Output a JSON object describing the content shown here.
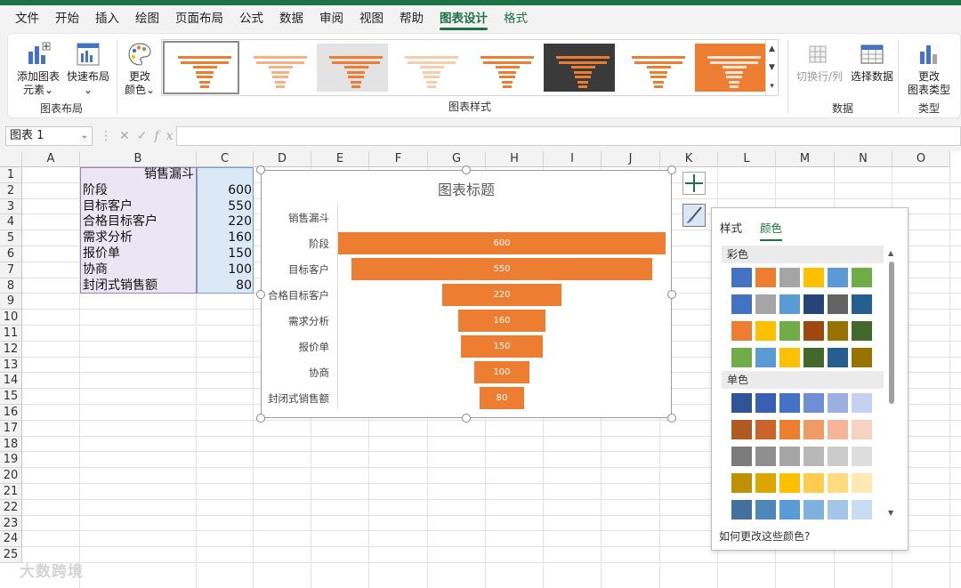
{
  "menu": {
    "items": [
      "文件",
      "开始",
      "插入",
      "绘图",
      "页面布局",
      "公式",
      "数据",
      "审阅",
      "视图",
      "帮助",
      "图表设计",
      "格式"
    ],
    "active": "图表设计"
  },
  "ribbon": {
    "layout_group": {
      "label": "图表布局",
      "add_element": "添加图表\n元素",
      "quick_layout": "快速布局"
    },
    "change_colors": "更改\n颜色",
    "styles_group_label": "图表样式",
    "data_group": {
      "label": "数据",
      "switch_row_col": "切换行/列",
      "select_data": "选择数据"
    },
    "type_group": {
      "label": "类型",
      "change_type": "更改\n图表类型"
    }
  },
  "formula_bar": {
    "name_box": "图表 1",
    "fx": "fx",
    "value": ""
  },
  "columns": [
    "A",
    "B",
    "C",
    "D",
    "E",
    "F",
    "G",
    "H",
    "I",
    "J",
    "K",
    "L",
    "M",
    "N",
    "O"
  ],
  "rows": [
    "1",
    "2",
    "3",
    "4",
    "5",
    "6",
    "7",
    "8",
    "9",
    "10",
    "11",
    "12",
    "13",
    "14",
    "15",
    "16",
    "17",
    "18",
    "19",
    "20",
    "21",
    "22",
    "23",
    "24",
    "25"
  ],
  "sheet": {
    "header": "销售漏斗",
    "data": [
      {
        "stage": "阶段",
        "value": "600"
      },
      {
        "stage": "目标客户",
        "value": "550"
      },
      {
        "stage": "合格目标客户",
        "value": "220"
      },
      {
        "stage": "需求分析",
        "value": "160"
      },
      {
        "stage": "报价单",
        "value": "150"
      },
      {
        "stage": "协商",
        "value": "100"
      },
      {
        "stage": "封闭式销售额",
        "value": "80"
      }
    ]
  },
  "chart_data": {
    "type": "funnel",
    "title": "图表标题",
    "categories": [
      "销售漏斗",
      "阶段",
      "目标客户",
      "合格目标客户",
      "需求分析",
      "报价单",
      "协商",
      "封闭式销售额"
    ],
    "values": [
      null,
      600,
      550,
      220,
      160,
      150,
      100,
      80
    ],
    "color": "#ed7d31",
    "data_labels": true
  },
  "color_panel": {
    "tabs": [
      "样式",
      "颜色"
    ],
    "active_tab": "颜色",
    "colorful_label": "彩色",
    "mono_label": "单色",
    "footer": "如何更改这些颜色?",
    "colorful_rows": [
      [
        "#4472c4",
        "#ed7d31",
        "#a5a5a5",
        "#ffc000",
        "#5b9bd5",
        "#70ad47"
      ],
      [
        "#4472c4",
        "#a5a5a5",
        "#5b9bd5",
        "#264478",
        "#636363",
        "#255e91"
      ],
      [
        "#ed7d31",
        "#ffc000",
        "#70ad47",
        "#9e480e",
        "#997300",
        "#43682b"
      ],
      [
        "#70ad47",
        "#5b9bd5",
        "#ffc000",
        "#43682b",
        "#255e91",
        "#997300"
      ]
    ],
    "mono_rows": [
      [
        "#2f5597",
        "#3a5fb0",
        "#4472c4",
        "#6f8ed4",
        "#9bb0e1",
        "#c5d1ee"
      ],
      [
        "#ae5a21",
        "#c9652a",
        "#ed7d31",
        "#f09a66",
        "#f4b598",
        "#f8d1c0"
      ],
      [
        "#7b7b7b",
        "#8f8f8f",
        "#a5a5a5",
        "#b8b8b8",
        "#cbcbcb",
        "#dddddd"
      ],
      [
        "#bf9000",
        "#dba600",
        "#ffc000",
        "#ffcd4d",
        "#ffdb80",
        "#ffe8b3"
      ],
      [
        "#41719c",
        "#4e86b8",
        "#5b9bd5",
        "#7fb1df",
        "#a3c6e8",
        "#c8dcf1"
      ]
    ]
  },
  "watermark": "大数跨境"
}
